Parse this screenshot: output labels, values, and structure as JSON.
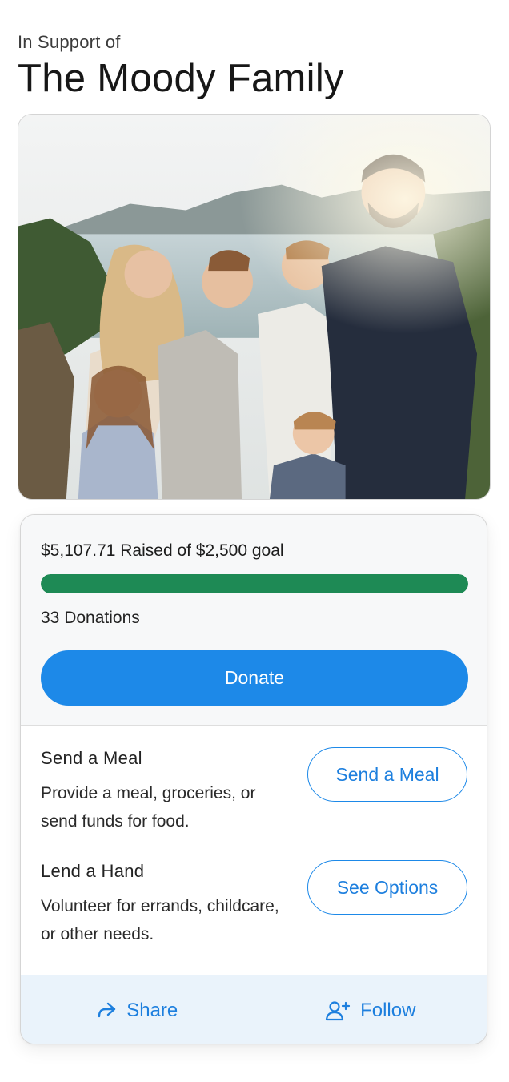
{
  "header": {
    "subtitle": "In Support of",
    "title": "The Moody Family"
  },
  "photo": {
    "alt": "Family photo of The Moody Family in front of a lake and mountains"
  },
  "fundraiser": {
    "raised_text": "$5,107.71 Raised of $2,500 goal",
    "progress_fraction": 1.0,
    "donations_text": "33 Donations",
    "donate_label": "Donate",
    "progress_color": "#1e8a55",
    "accent_color": "#1d89e8"
  },
  "help_options": [
    {
      "title": "Send a Meal",
      "description": "Provide a meal, groceries, or send funds for food.",
      "button_label": "Send a Meal"
    },
    {
      "title": "Lend a Hand",
      "description": "Volunteer for errands, childcare, or other needs.",
      "button_label": "See Options"
    }
  ],
  "actions": {
    "share_label": "Share",
    "share_icon": "share-arrow-icon",
    "follow_label": "Follow",
    "follow_icon": "person-add-icon"
  }
}
